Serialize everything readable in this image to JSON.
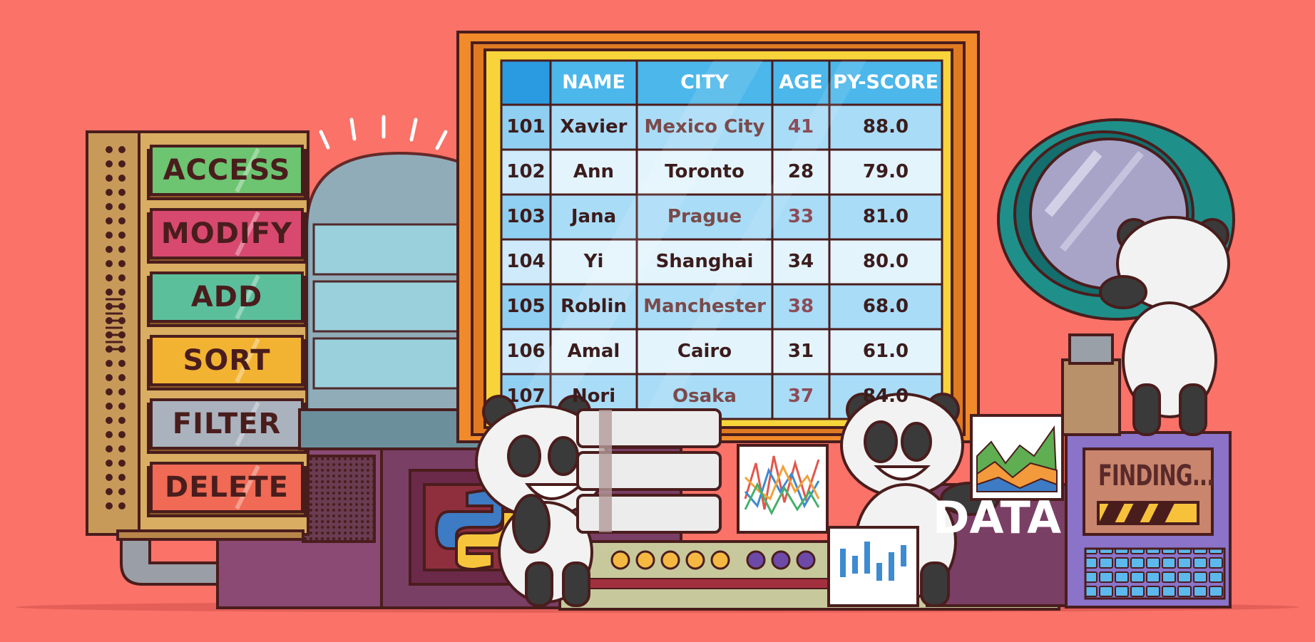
{
  "palette": {
    "background": "#fa7268",
    "outline": "#4a1d1d",
    "table_header": "#4cb7ea",
    "table_row_light": "#e4f4fd",
    "table_row_blue": "#a9dcf7",
    "frame_orange": "#f08a2a",
    "frame_yellow": "#f7d43a"
  },
  "buttons": [
    {
      "label": "ACCESS",
      "color": "#6dc471",
      "icon": "access-button"
    },
    {
      "label": "MODIFY",
      "color": "#d8496f",
      "icon": "modify-button"
    },
    {
      "label": "ADD",
      "color": "#5cbf9c",
      "icon": "add-button"
    },
    {
      "label": "SORT",
      "color": "#f2b332",
      "icon": "sort-button"
    },
    {
      "label": "FILTER",
      "color": "#aab2bd",
      "icon": "filter-button"
    },
    {
      "label": "DELETE",
      "color": "#f06a55",
      "icon": "delete-button"
    }
  ],
  "table": {
    "columns": [
      "",
      "NAME",
      "CITY",
      "AGE",
      "PY-SCORE"
    ],
    "rows": [
      {
        "id": "101",
        "name": "Xavier",
        "city": "Mexico City",
        "age": "41",
        "score": "88.0"
      },
      {
        "id": "102",
        "name": "Ann",
        "city": "Toronto",
        "age": "28",
        "score": "79.0"
      },
      {
        "id": "103",
        "name": "Jana",
        "city": "Prague",
        "age": "33",
        "score": "81.0"
      },
      {
        "id": "104",
        "name": "Yi",
        "city": "Shanghai",
        "age": "34",
        "score": "80.0"
      },
      {
        "id": "105",
        "name": "Roblin",
        "city": "Manchester",
        "age": "38",
        "score": "68.0"
      },
      {
        "id": "106",
        "name": "Amal",
        "city": "Cairo",
        "age": "31",
        "score": "61.0"
      },
      {
        "id": "107",
        "name": "Nori",
        "city": "Osaka",
        "age": "37",
        "score": "84.0"
      }
    ]
  },
  "machine": {
    "finding_text": "FINDING...",
    "data_text": "DATA"
  },
  "icons": [
    "python-logo-icon",
    "database-stack-icon",
    "magnifying-glass-icon",
    "line-chart-icon",
    "area-chart-icon",
    "bar-chart-icon",
    "panda-icon",
    "glass-dome-icon"
  ]
}
